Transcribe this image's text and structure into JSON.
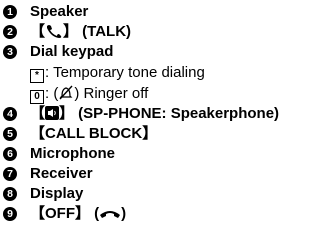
{
  "items": [
    {
      "number": "1",
      "label": "Speaker"
    },
    {
      "number": "2",
      "prefix": "【",
      "suffix": "】 (TALK)",
      "icon": "talk-handset-icon"
    },
    {
      "number": "3",
      "label": "Dial keypad",
      "sub": [
        {
          "key": "*",
          "key_icon": "asterisk-key-icon",
          "text": ": Temporary tone dialing"
        },
        {
          "key": "0",
          "key_icon": "zero-key-icon",
          "text_before": ": (",
          "icon": "ringer-off-icon",
          "text_after": ") Ringer off"
        }
      ]
    },
    {
      "number": "4",
      "prefix": "【",
      "suffix": "】 (SP-PHONE: Speakerphone)",
      "icon": "speakerphone-icon"
    },
    {
      "number": "5",
      "label": "【CALL BLOCK】"
    },
    {
      "number": "6",
      "label": "Microphone"
    },
    {
      "number": "7",
      "label": "Receiver"
    },
    {
      "number": "8",
      "label": "Display"
    },
    {
      "number": "9",
      "prefix": "【OFF】 (",
      "suffix": ")",
      "icon": "off-handset-icon"
    }
  ]
}
